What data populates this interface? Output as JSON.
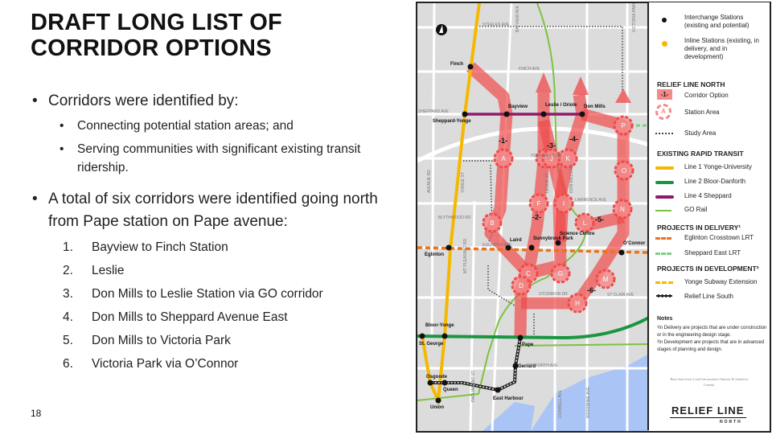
{
  "slide": {
    "title": "DRAFT LONG LIST OF CORRIDOR OPTIONS",
    "page_number": "18",
    "bullets": [
      {
        "text": "Corridors were identified by:",
        "sub": [
          "Connecting potential station areas; and",
          "Serving communities with significant existing transit ridership."
        ]
      },
      {
        "text": "A total of six corridors were identified going north from Pape station on Pape avenue:"
      }
    ],
    "corridors": [
      "Bayview to Finch Station",
      "Leslie",
      "Don Mills to Leslie Station via GO corridor",
      "Don Mills to Sheppard Avenue East",
      "Don Mills to Victoria Park",
      "Victoria Park via O’Connor"
    ]
  },
  "legend": {
    "interchange": "Interchange Stations (existing and potential)",
    "inline": "Inline Stations (existing, in delivery, and in development)",
    "rln_heading": "RELIEF LINE NORTH",
    "corridor_option": "Corridor Option",
    "corridor_swatch": "-1-",
    "station_area": "Station Area",
    "station_swatch": "A",
    "study_area": "Study Area",
    "existing_heading": "EXISTING RAPID TRANSIT",
    "line1": "Line 1 Yonge-University",
    "line2": "Line 2 Bloor-Danforth",
    "line4": "Line 4 Sheppard",
    "go": "GO Rail",
    "delivery_heading": "PROJECTS IN DELIVERY¹",
    "eglinton": "Eglinton Crosstown LRT",
    "sheppard_east": "Sheppard East LRT",
    "development_heading": "PROJECTS IN DEVELOPMENT²",
    "yonge_ext": "Yonge Subway Extension",
    "rls": "Relief Line South",
    "notes_heading": "Notes",
    "note1": "¹In Delivery are projects that are under construction or in the engineering design stage.",
    "note2": "²In Development are projects that are in advanced stages of planning and design.",
    "credit": "Base data from Land Information Ontario & Statistics Canada.",
    "logo": "RELIEF LINE",
    "logo_sub": "NORTH"
  },
  "colors": {
    "line1": "#f5b800",
    "line2": "#1a9641",
    "line4": "#8e1a6b",
    "go": "#7dc242",
    "eglinton": "#e8731c",
    "sheppard_east": "#7fcf8c",
    "corridor": "#f04a4a",
    "water": "#a9c4f5"
  },
  "map": {
    "streets": [
      "STEELES AVE",
      "FINCH AVE",
      "SHEPPARD AVE",
      "YORK MILLS RD",
      "LAWRENCE AVE",
      "EGLINTON AVE",
      "BLYTHWOOD RD",
      "O'CONNOR DR",
      "ST CLAIR AVE",
      "DANFORTH AVE",
      "BAYVIEW AVE",
      "VICTORIA PARK AVE",
      "AVENUE RD",
      "YONGE ST",
      "MT PLEASANT RD",
      "PARLIAMENT ST",
      "COXWELL AVE",
      "WOODBINE AVE",
      "LESLIE ST",
      "DON MILLS RD"
    ],
    "stations": [
      "Finch",
      "Sheppard-Yonge",
      "Bayview",
      "Leslie / Oriole",
      "Don Mills",
      "Eglinton",
      "Laird",
      "Sunnybrook Park",
      "Science Centre",
      "O'Connor",
      "Bloor-Yonge",
      "St. George",
      "Pape",
      "Gerrard",
      "Osgoode",
      "Queen",
      "Union",
      "East Harbour"
    ],
    "station_areas": [
      "A",
      "E",
      "J",
      "K",
      "F",
      "I",
      "N",
      "O",
      "P",
      "B",
      "L",
      "C",
      "G",
      "D",
      "M",
      "H"
    ],
    "corridor_labels": [
      "-1-",
      "-2-",
      "-3-",
      "-4-",
      "-5-",
      "-6-"
    ]
  }
}
